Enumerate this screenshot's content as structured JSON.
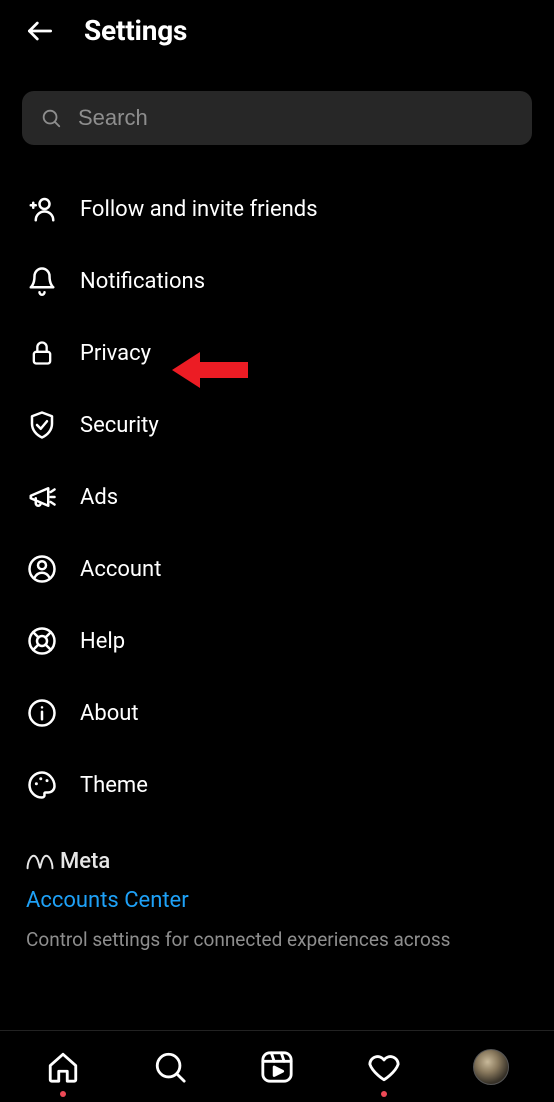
{
  "header": {
    "title": "Settings"
  },
  "search": {
    "placeholder": "Search"
  },
  "menu": {
    "items": [
      {
        "id": "follow-invite",
        "label": "Follow and invite friends"
      },
      {
        "id": "notifications",
        "label": "Notifications"
      },
      {
        "id": "privacy",
        "label": "Privacy"
      },
      {
        "id": "security",
        "label": "Security"
      },
      {
        "id": "ads",
        "label": "Ads"
      },
      {
        "id": "account",
        "label": "Account"
      },
      {
        "id": "help",
        "label": "Help"
      },
      {
        "id": "about",
        "label": "About"
      },
      {
        "id": "theme",
        "label": "Theme"
      }
    ]
  },
  "meta": {
    "brand": "Meta",
    "link": "Accounts Center",
    "desc": "Control settings for connected experiences across"
  }
}
